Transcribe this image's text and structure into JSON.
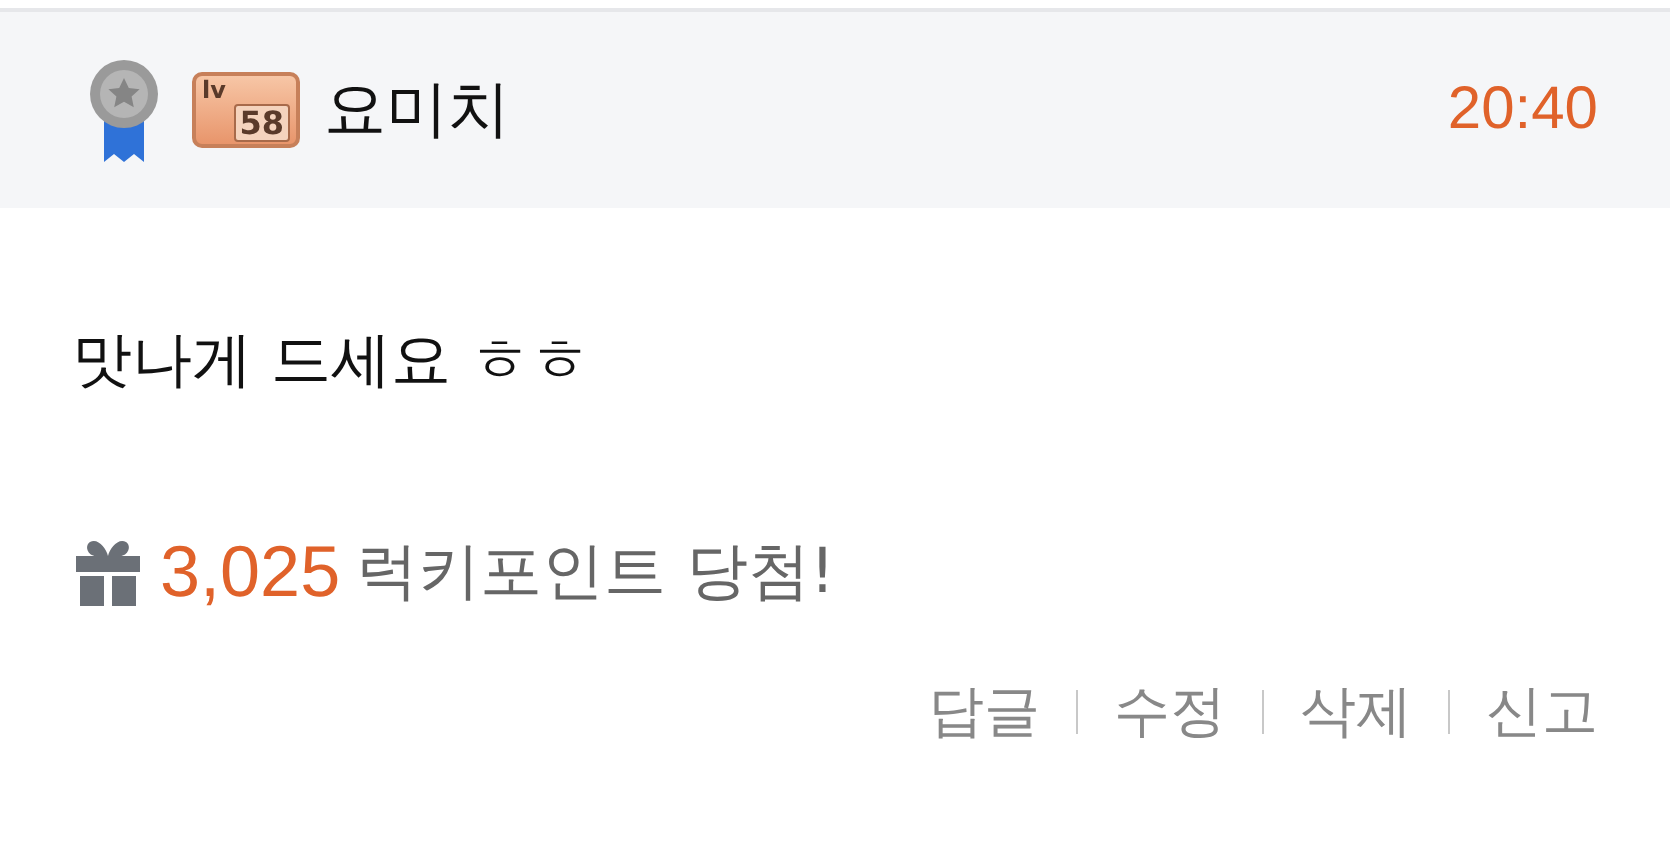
{
  "author": {
    "level_badge": {
      "prefix": "lv",
      "level": "58"
    },
    "name": "요미치",
    "time": "20:40"
  },
  "comment": {
    "text": "맛나게 드세요 ㅎㅎ"
  },
  "reward": {
    "points": "3,025",
    "label": "럭키포인트 당첨!"
  },
  "actions": [
    "답글",
    "수정",
    "삭제",
    "신고"
  ]
}
